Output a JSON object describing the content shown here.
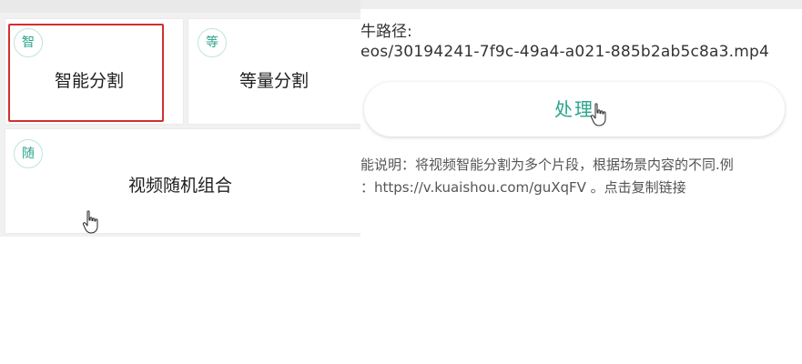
{
  "left_panel": {
    "cards": {
      "smart": {
        "badge": "智",
        "label": "智能分割"
      },
      "equal": {
        "badge": "等",
        "label": "等量分割"
      },
      "random": {
        "badge": "随",
        "label": "视频随机组合"
      }
    }
  },
  "right_panel": {
    "path_label": "牛路径:",
    "path_value": "eos/30194241-7f9c-49a4-a021-885b2ab5c8a3.mp4",
    "process_button": "处理",
    "description_line1": "能说明：将视频智能分割为多个片段，根据场景内容的不同.例",
    "description_line2": "：https://v.kuaishou.com/guXqFV 。点击复制链接"
  },
  "colors": {
    "accent": "#2aa58b",
    "highlight": "#d0302f"
  },
  "icons": [
    "hand-cursor-icon"
  ]
}
